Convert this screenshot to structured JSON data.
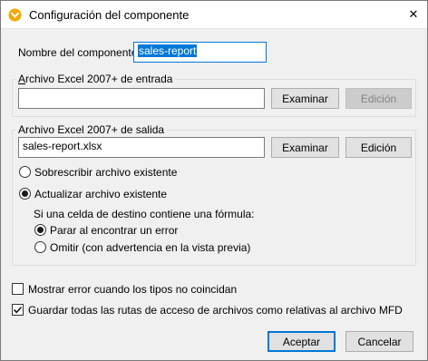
{
  "window": {
    "title": "Configuración del componente",
    "app_icon": "mapforce-icon",
    "close_glyph": "✕"
  },
  "component_name": {
    "label": "Nombre del componente:",
    "value": "sales-report"
  },
  "input_group": {
    "title": "Archivo Excel 2007+ de entrada",
    "value": "",
    "browse_label": "Examinar",
    "edit_label": "Edición"
  },
  "output_group": {
    "title": "Archivo Excel 2007+ de salida",
    "value": "sales-report.xlsx",
    "browse_label": "Examinar",
    "edit_label": "Edición",
    "overwrite_label": "Sobrescribir archivo existente",
    "update_label": "Actualizar archivo existente",
    "formula_label": "Si una celda de destino contiene una fórmula:",
    "stop_label": "Parar al encontrar un error",
    "omit_label": "Omitir (con advertencia en la vista previa)"
  },
  "options": {
    "type_mismatch_label": "Mostrar error cuando los tipos no coincidan",
    "relative_paths_label": "Guardar todas las rutas de acceso de archivos como relativas al archivo MFD"
  },
  "footer": {
    "ok_label": "Aceptar",
    "cancel_label": "Cancelar"
  },
  "state": {
    "output_mode": "update",
    "formula_mode": "stop",
    "type_mismatch_checked": false,
    "relative_paths_checked": true
  },
  "colors": {
    "selection": "#0078d7",
    "app_icon": "#f5a800"
  }
}
